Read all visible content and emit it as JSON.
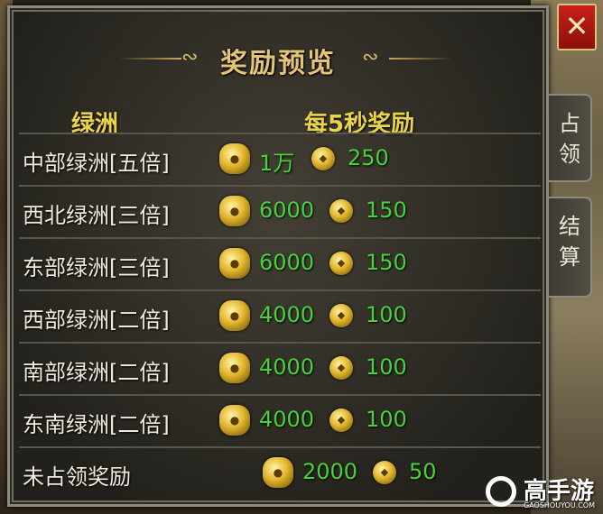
{
  "panel": {
    "title": "奖励预览",
    "col_oasis": "绿洲",
    "col_reward": "每5秒奖励"
  },
  "rows": [
    {
      "name": "中部绿洲[五倍]",
      "reward_a": "1万",
      "reward_b": "250"
    },
    {
      "name": "西北绿洲[三倍]",
      "reward_a": "6000",
      "reward_b": "150"
    },
    {
      "name": "东部绿洲[三倍]",
      "reward_a": "6000",
      "reward_b": "150"
    },
    {
      "name": "西部绿洲[二倍]",
      "reward_a": "4000",
      "reward_b": "100"
    },
    {
      "name": "南部绿洲[二倍]",
      "reward_a": "4000",
      "reward_b": "100"
    },
    {
      "name": "东南绿洲[二倍]",
      "reward_a": "4000",
      "reward_b": "100"
    },
    {
      "name": "未占领奖励",
      "reward_a": "2000",
      "reward_b": "50"
    }
  ],
  "side_tabs": {
    "occupy": "占领",
    "settle": "结算"
  },
  "close": {
    "label": "✕"
  },
  "watermark": {
    "text": "高手游",
    "sub": "GAOSHOUYOU.COM"
  },
  "icons": {
    "reward_a": "gold-ingot-icon",
    "reward_b": "coin-icon"
  },
  "colors": {
    "value_green": "#47d23a",
    "header_yellow": "#e8d34a",
    "title_gold": "#e3c479"
  }
}
